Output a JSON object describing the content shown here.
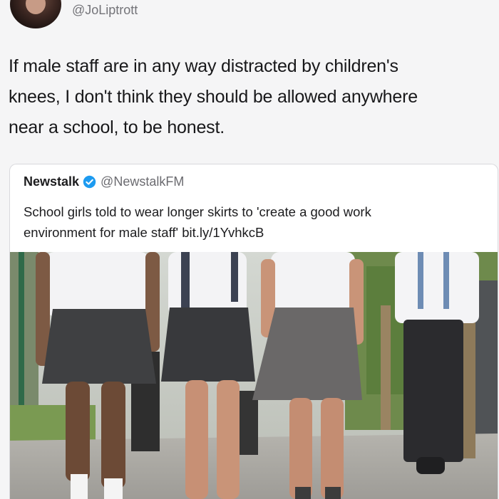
{
  "tweet": {
    "handle": "@JoLiptrott",
    "text_lines": [
      "If male staff are in any way distracted by children's",
      "knees, I don't think they should be allowed anywhere",
      "near a school, to be honest."
    ]
  },
  "quoted_tweet": {
    "name": "Newstalk",
    "verified": true,
    "handle": "@NewstalkFM",
    "text_lines": [
      "School girls told to wear longer skirts to 'create a good work",
      "environment for male staff' bit.ly/1YvhkcB"
    ],
    "image": "school-pupils-walking-photo"
  },
  "colors": {
    "background": "#f5f5f6",
    "verified_badge": "#1d9bf0",
    "handle_text": "#737378"
  }
}
